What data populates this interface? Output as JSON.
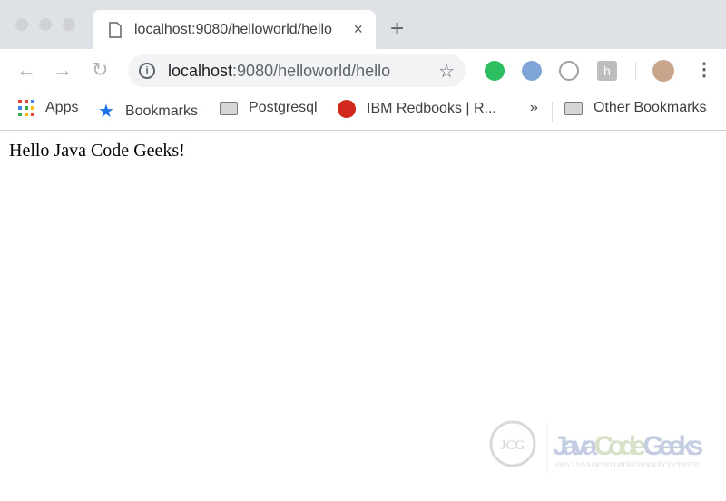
{
  "tab": {
    "title": "localhost:9080/helloworld/hello",
    "close": "×",
    "new_tab": "+"
  },
  "omnibox": {
    "host": "localhost",
    "rest": ":9080/helloworld/hello"
  },
  "bookmarks": [
    {
      "label": "Apps",
      "icon": "apps-grid-icon"
    },
    {
      "label": "Bookmarks",
      "icon": "star-icon"
    },
    {
      "label": "Postgresql",
      "icon": "folder-icon"
    },
    {
      "label": "IBM Redbooks | R...",
      "icon": "redbooks-icon"
    },
    {
      "label": "Other Bookmarks",
      "icon": "folder-icon"
    }
  ],
  "overflow": "»",
  "page": {
    "text": "Hello Java Code Geeks!"
  },
  "watermark": {
    "logo": "JCG",
    "name": "Java Code Geeks",
    "tagline": "Java 2 Java Developers Resource Center"
  }
}
